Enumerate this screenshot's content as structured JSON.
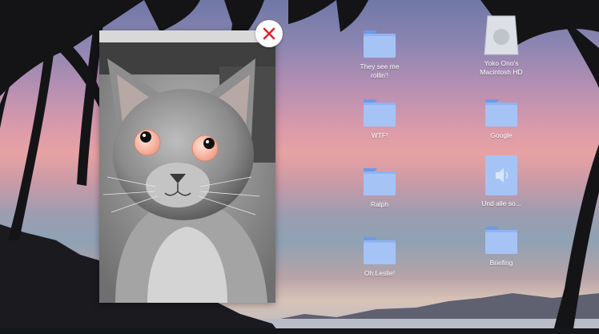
{
  "desktop_icons": [
    {
      "kind": "folder",
      "label": "They see me rollin'!"
    },
    {
      "kind": "drive",
      "label": "Yoko Ono's Macintosh HD"
    },
    {
      "kind": "folder",
      "label": "WTF!"
    },
    {
      "kind": "folder",
      "label": "Google"
    },
    {
      "kind": "folder",
      "label": "Ralph"
    },
    {
      "kind": "audio-file",
      "label": "Und alle so..."
    },
    {
      "kind": "folder",
      "label": "Oh Leslie!"
    },
    {
      "kind": "folder",
      "label": "Briefing"
    }
  ],
  "viewer": {
    "image_subject": "grey kitten with googly eyes"
  },
  "colors": {
    "folder_blue": "#8fb3f3",
    "close_red": "#e3202a"
  }
}
